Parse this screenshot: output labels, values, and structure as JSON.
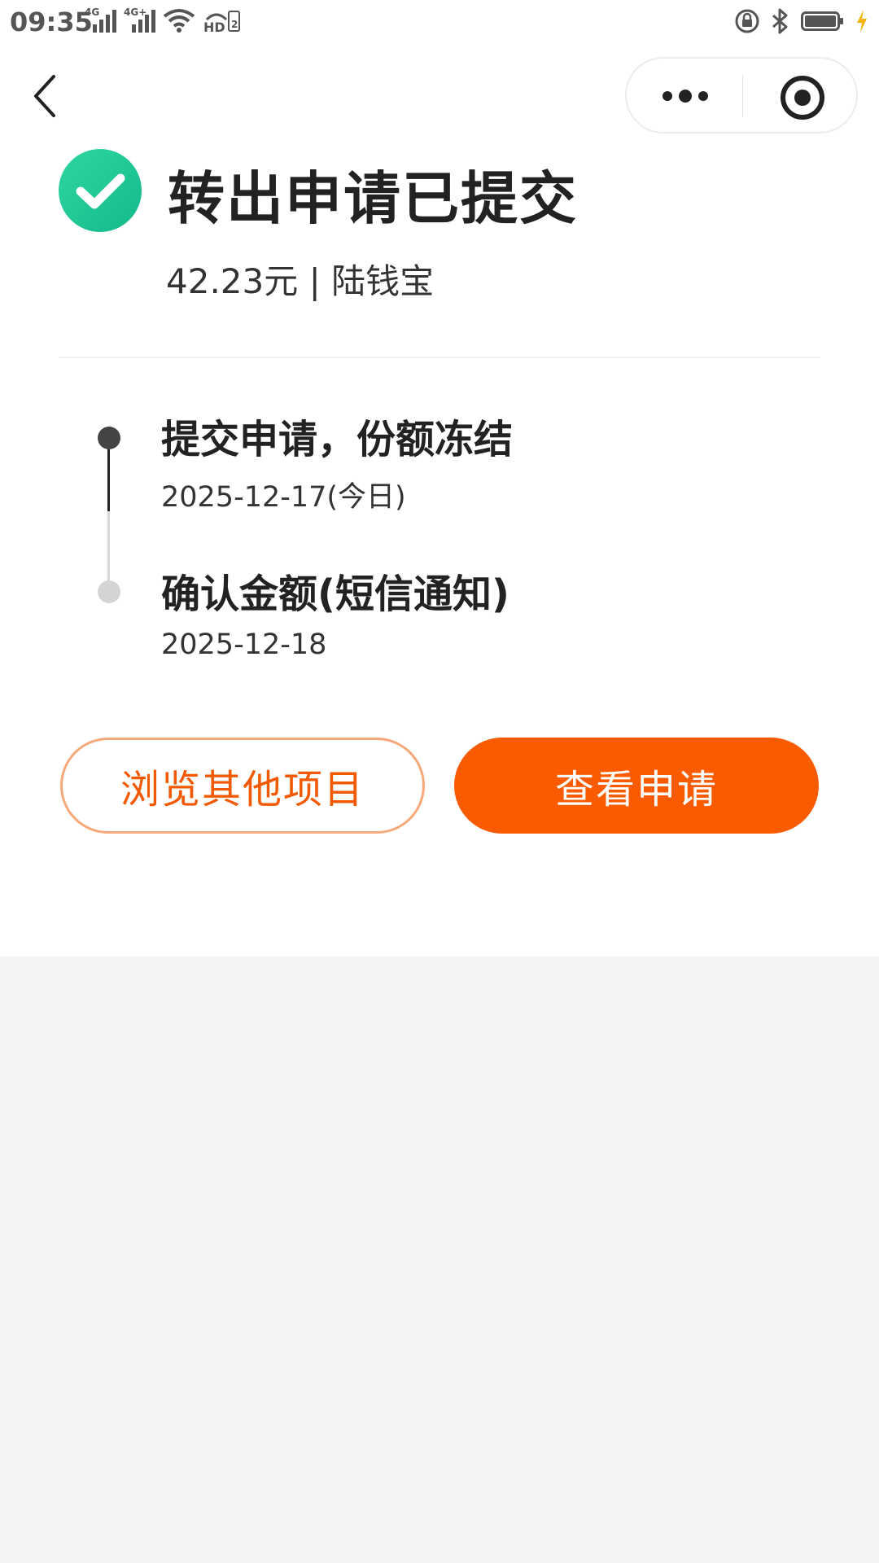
{
  "status_bar": {
    "time": "09:35",
    "sim1_tag": "4G",
    "sim2_tag": "4G+",
    "hd_label": "HD",
    "hd_sub": "2",
    "icons": [
      "signal-icon",
      "wifi-icon",
      "hd-voice-icon",
      "rotation-lock-icon",
      "bluetooth-icon",
      "battery-icon",
      "charging-icon"
    ]
  },
  "nav": {
    "back_icon": "chevron-left-icon",
    "more_icon": "more-dots-icon",
    "close_icon": "target-circle-icon"
  },
  "header": {
    "title": "转出申请已提交",
    "amount_line": "42.23元 | 陆钱宝",
    "status_icon": "check-circle-icon",
    "accent_color": "#1cc493"
  },
  "timeline": {
    "steps": [
      {
        "title": "提交申请，份额冻结",
        "date": "2025-12-17(今日)"
      },
      {
        "title": "确认金额(短信通知)",
        "date": "2025-12-18"
      }
    ]
  },
  "actions": {
    "browse_label": "浏览其他项目",
    "view_label": "查看申请",
    "primary_color": "#fb5b00"
  }
}
